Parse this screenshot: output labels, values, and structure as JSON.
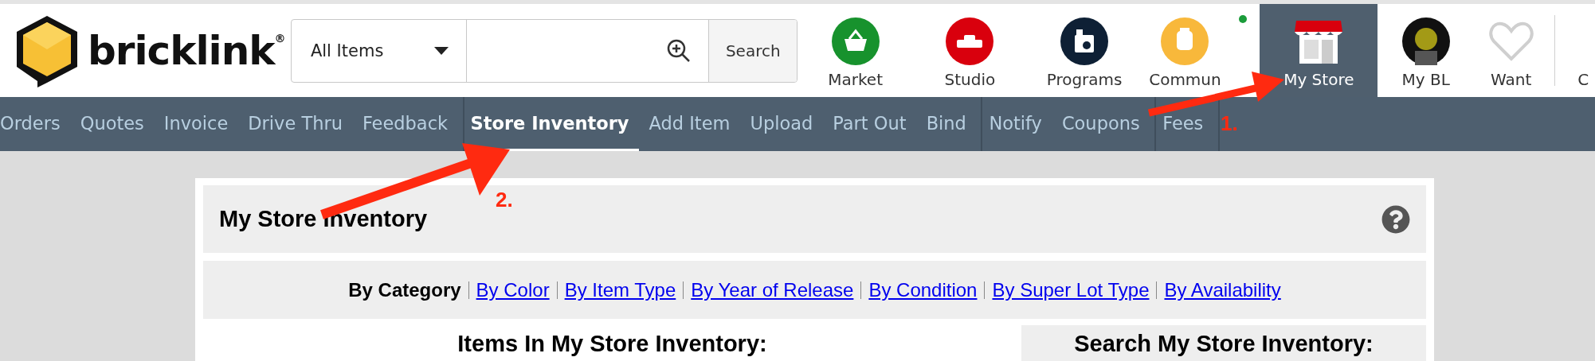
{
  "header": {
    "logo": "bricklink$^{®}$",
    "search": {
      "category": "All Items",
      "button": "Search"
    },
    "nav": [
      {
        "kind": "market",
        "label": "Market",
        "selected": false,
        "badge": false
      },
      {
        "kind": "studio",
        "label": "Studio",
        "selected": false,
        "badge": false
      },
      {
        "kind": "programs",
        "label": "Programs",
        "selected": false,
        "badge": false
      },
      {
        "kind": "community",
        "label": "Commun",
        "selected": false,
        "badge": true
      },
      {
        "kind": "store",
        "label": "My Store",
        "selected": true,
        "badge": false
      },
      {
        "kind": "avatar",
        "label": "My BL",
        "selected": false,
        "badge": false
      },
      {
        "kind": "want",
        "label": "Want",
        "selected": false,
        "badge": false
      },
      {
        "kind": "cut",
        "label": "C",
        "selected": false,
        "badge": false
      }
    ]
  },
  "subnav": [
    [
      {
        "label": "Orders",
        "selected": false
      },
      {
        "label": "Quotes",
        "selected": false
      },
      {
        "label": "Invoice",
        "selected": false
      },
      {
        "label": "Drive Thru",
        "selected": false
      },
      {
        "label": "Feedback",
        "selected": false
      }
    ],
    [
      {
        "label": "Store Inventory",
        "selected": true
      },
      {
        "label": "Add Item",
        "selected": false
      },
      {
        "label": "Upload",
        "selected": false
      },
      {
        "label": "Part Out",
        "selected": false
      },
      {
        "label": "Bind",
        "selected": false
      }
    ],
    [
      {
        "label": "Notify",
        "selected": false
      },
      {
        "label": "Coupons",
        "selected": false
      }
    ],
    [
      {
        "label": "Fees",
        "selected": false
      }
    ]
  ],
  "panel": {
    "title": "My Store Inventory",
    "views": [
      {
        "label": "By Category",
        "selected": true
      },
      {
        "label": "By Color",
        "selected": false
      },
      {
        "label": "By Item Type",
        "selected": false
      },
      {
        "label": "By Year of Release",
        "selected": false
      },
      {
        "label": "By Condition",
        "selected": false
      },
      {
        "label": "By Super Lot Type",
        "selected": false
      },
      {
        "label": "By Availability",
        "selected": false
      }
    ],
    "items_heading": "Items In My Store Inventory:",
    "search_heading": "Search My Store Inventory:"
  },
  "annotations": [
    {
      "label": "1."
    },
    {
      "label": "2."
    }
  ]
}
